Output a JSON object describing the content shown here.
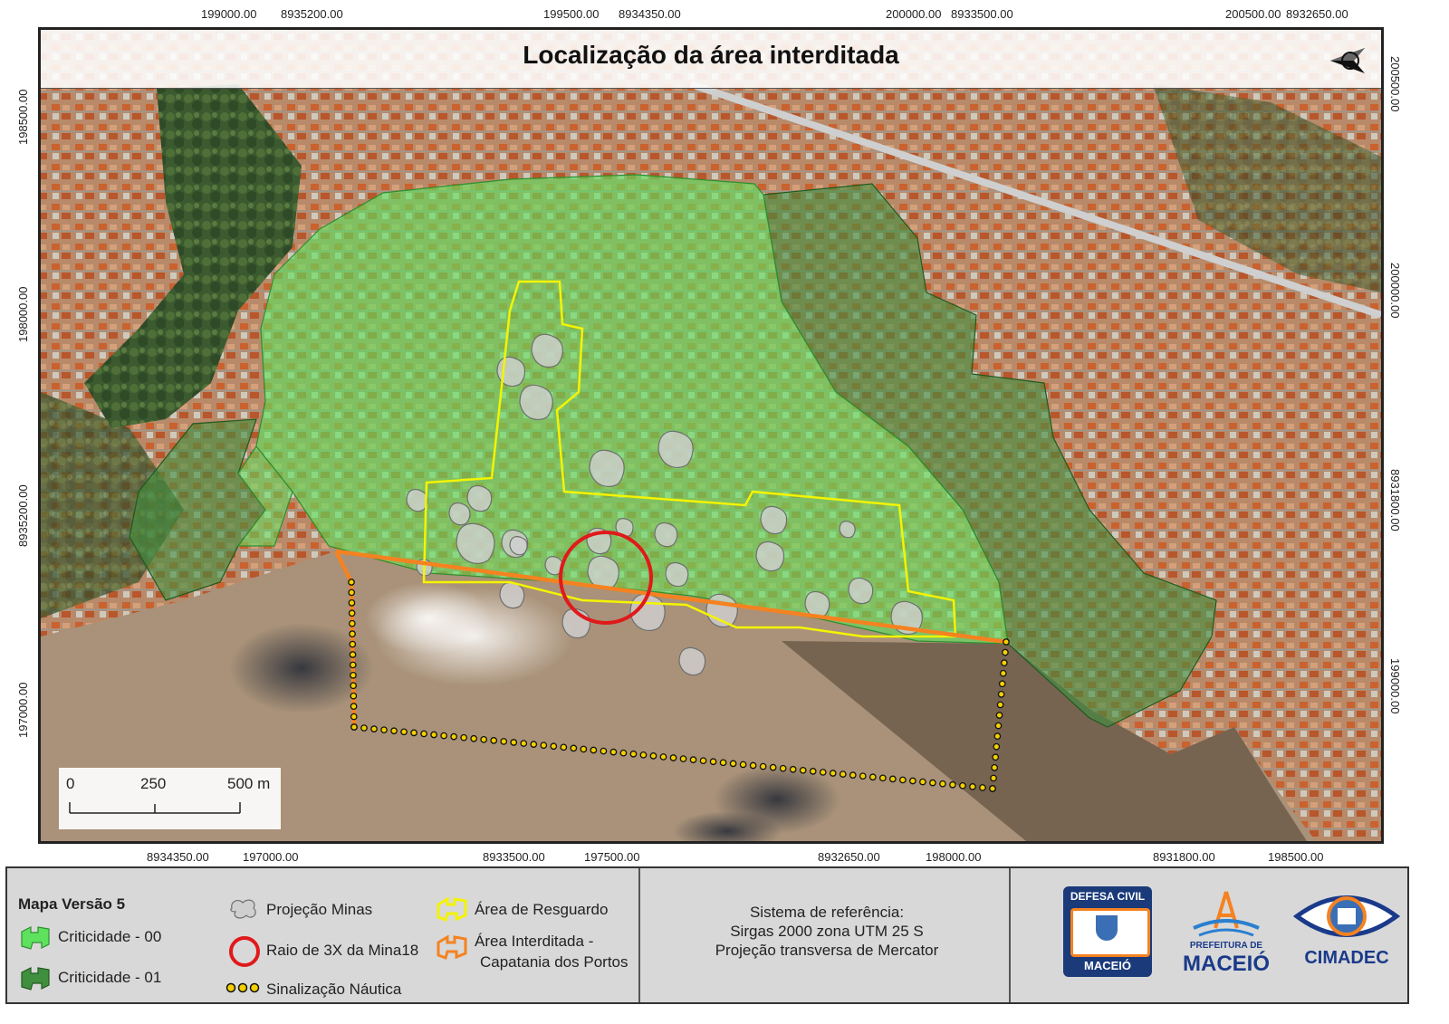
{
  "map": {
    "title": "Localização da área interditada",
    "top_coords": [
      "199000.00",
      "8935200.00",
      "199500.00",
      "8934350.00",
      "200000.00",
      "8933500.00",
      "200500.00",
      "8932650.00"
    ],
    "bottom_coords": [
      "8934350.00",
      "197000.00",
      "8933500.00",
      "197500.00",
      "8932650.00",
      "198000.00",
      "8931800.00",
      "198500.00"
    ],
    "left_coords": [
      "198500.00",
      "198000.00",
      "8935200.00",
      "197000.00"
    ],
    "right_coords": [
      "200500.00",
      "200000.00",
      "8931800.00",
      "199000.00"
    ],
    "scale_bar": {
      "labels": [
        "0",
        "250",
        "500 m"
      ]
    },
    "north_arrow_icon": "north-arrow-icon"
  },
  "legend": {
    "version_title": "Mapa Versão 5",
    "items": {
      "criticidade_00": "Criticidade - 00",
      "criticidade_01": "Criticidade - 01",
      "projecao_minas": "Projeção Minas",
      "raio_mina18": "Raio de 3X da Mina18",
      "sinalizacao_nautica": "Sinalização Náutica",
      "area_resguardo": "Área de Resguardo",
      "area_interditada_1": "Área Interditada -",
      "area_interditada_2": "Capatania dos Portos"
    },
    "colors": {
      "criticidade_00": "#5ee25e",
      "criticidade_01": "#3f8f3f",
      "projecao_minas": "#c8c8c8",
      "raio_mina18": "#e0191b",
      "area_resguardo": "#f4f400",
      "area_interditada": "#f58220",
      "sinalizacao_nautica": "#f4d000"
    },
    "reference": {
      "line1": "Sistema de referência:",
      "line2": "Sirgas 2000 zona UTM 25 S",
      "line3": "Projeção transversa de Mercator"
    },
    "logos": {
      "defesa_civil_top": "DEFESA CIVIL",
      "defesa_civil_bottom": "MACEIÓ",
      "prefeitura_small": "PREFEITURA DE",
      "prefeitura_big": "MACEIÓ",
      "cimadec": "CIMADEC"
    }
  }
}
